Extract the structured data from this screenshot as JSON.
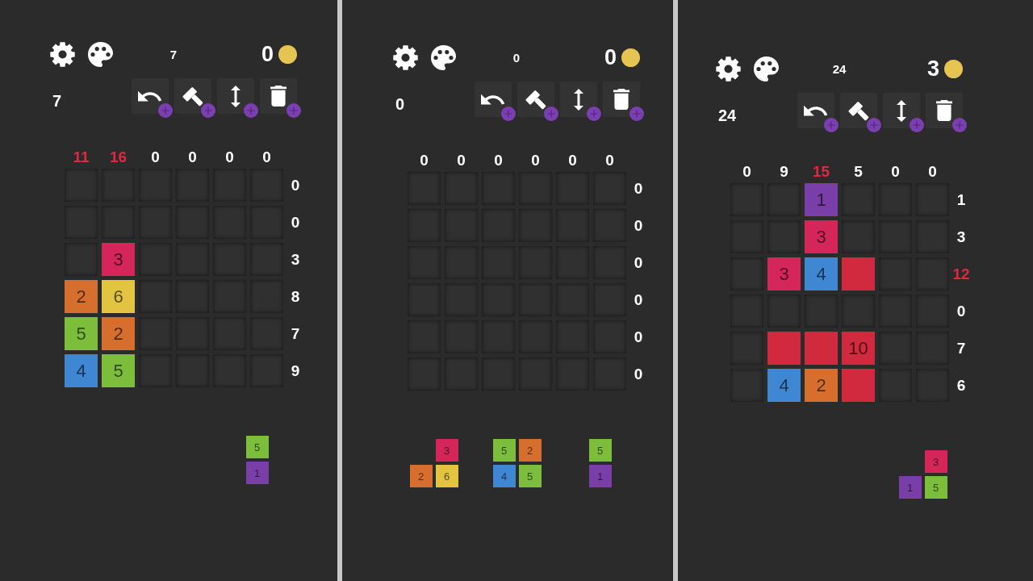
{
  "panels": [
    {
      "top_number": "7",
      "coins": "0",
      "side_number": "7",
      "tools": [
        {
          "kind": "undo",
          "add_badge": true
        },
        {
          "kind": "hammer",
          "add_badge": true
        },
        {
          "kind": "arrows",
          "add_badge": true
        },
        {
          "kind": "trash",
          "add_badge": true
        }
      ],
      "grid": {
        "column_sums": [
          {
            "text": "11",
            "over_limit": true
          },
          {
            "text": "16",
            "over_limit": true
          },
          {
            "text": "0",
            "over_limit": false
          },
          {
            "text": "0",
            "over_limit": false
          },
          {
            "text": "0",
            "over_limit": false
          },
          {
            "text": "0",
            "over_limit": false
          }
        ],
        "rows": [
          {
            "sum": {
              "text": "0",
              "over_limit": false
            },
            "cells": [
              {
                "kind": "empty"
              },
              {
                "kind": "empty"
              },
              {
                "kind": "empty"
              },
              {
                "kind": "empty"
              },
              {
                "kind": "empty"
              },
              {
                "kind": "empty"
              }
            ]
          },
          {
            "sum": {
              "text": "0",
              "over_limit": false
            },
            "cells": [
              {
                "kind": "empty"
              },
              {
                "kind": "empty"
              },
              {
                "kind": "empty"
              },
              {
                "kind": "empty"
              },
              {
                "kind": "empty"
              },
              {
                "kind": "empty"
              }
            ]
          },
          {
            "sum": {
              "text": "3",
              "over_limit": false
            },
            "cells": [
              {
                "kind": "empty"
              },
              {
                "kind": "tile",
                "value": "3",
                "color": "#d42658"
              },
              {
                "kind": "empty"
              },
              {
                "kind": "empty"
              },
              {
                "kind": "empty"
              },
              {
                "kind": "empty"
              }
            ]
          },
          {
            "sum": {
              "text": "8",
              "over_limit": false
            },
            "cells": [
              {
                "kind": "tile",
                "value": "2",
                "color": "#d66e2d"
              },
              {
                "kind": "tile",
                "value": "6",
                "color": "#e3c441"
              },
              {
                "kind": "empty"
              },
              {
                "kind": "empty"
              },
              {
                "kind": "empty"
              },
              {
                "kind": "empty"
              }
            ]
          },
          {
            "sum": {
              "text": "7",
              "over_limit": false
            },
            "cells": [
              {
                "kind": "tile",
                "value": "5",
                "color": "#7cbe3c"
              },
              {
                "kind": "tile",
                "value": "2",
                "color": "#d66e2d"
              },
              {
                "kind": "empty"
              },
              {
                "kind": "empty"
              },
              {
                "kind": "empty"
              },
              {
                "kind": "empty"
              }
            ]
          },
          {
            "sum": {
              "text": "9",
              "over_limit": false
            },
            "cells": [
              {
                "kind": "tile",
                "value": "4",
                "color": "#3f86d3"
              },
              {
                "kind": "tile",
                "value": "5",
                "color": "#7cbe3c"
              },
              {
                "kind": "empty"
              },
              {
                "kind": "empty"
              },
              {
                "kind": "empty"
              },
              {
                "kind": "empty"
              }
            ]
          }
        ]
      },
      "tray": [
        {
          "kind": "empty"
        },
        {
          "kind": "empty"
        },
        {
          "kind": "piece",
          "rows": [
            {
              "cells": [
                {
                  "kind": "tile",
                  "value": "5",
                  "color": "#7cbe3c"
                }
              ]
            },
            {
              "cells": [
                {
                  "kind": "tile",
                  "value": "1",
                  "color": "#7a3ea9"
                }
              ]
            }
          ]
        }
      ]
    },
    {
      "top_number": "0",
      "coins": "0",
      "side_number": "0",
      "tools": [
        {
          "kind": "undo",
          "add_badge": true
        },
        {
          "kind": "hammer",
          "add_badge": true
        },
        {
          "kind": "arrows",
          "add_badge": true
        },
        {
          "kind": "trash",
          "add_badge": true
        }
      ],
      "grid": {
        "column_sums": [
          {
            "text": "0",
            "over_limit": false
          },
          {
            "text": "0",
            "over_limit": false
          },
          {
            "text": "0",
            "over_limit": false
          },
          {
            "text": "0",
            "over_limit": false
          },
          {
            "text": "0",
            "over_limit": false
          },
          {
            "text": "0",
            "over_limit": false
          }
        ],
        "rows": [
          {
            "sum": {
              "text": "0",
              "over_limit": false
            },
            "cells": [
              {
                "kind": "empty"
              },
              {
                "kind": "empty"
              },
              {
                "kind": "empty"
              },
              {
                "kind": "empty"
              },
              {
                "kind": "empty"
              },
              {
                "kind": "empty"
              }
            ]
          },
          {
            "sum": {
              "text": "0",
              "over_limit": false
            },
            "cells": [
              {
                "kind": "empty"
              },
              {
                "kind": "empty"
              },
              {
                "kind": "empty"
              },
              {
                "kind": "empty"
              },
              {
                "kind": "empty"
              },
              {
                "kind": "empty"
              }
            ]
          },
          {
            "sum": {
              "text": "0",
              "over_limit": false
            },
            "cells": [
              {
                "kind": "empty"
              },
              {
                "kind": "empty"
              },
              {
                "kind": "empty"
              },
              {
                "kind": "empty"
              },
              {
                "kind": "empty"
              },
              {
                "kind": "empty"
              }
            ]
          },
          {
            "sum": {
              "text": "0",
              "over_limit": false
            },
            "cells": [
              {
                "kind": "empty"
              },
              {
                "kind": "empty"
              },
              {
                "kind": "empty"
              },
              {
                "kind": "empty"
              },
              {
                "kind": "empty"
              },
              {
                "kind": "empty"
              }
            ]
          },
          {
            "sum": {
              "text": "0",
              "over_limit": false
            },
            "cells": [
              {
                "kind": "empty"
              },
              {
                "kind": "empty"
              },
              {
                "kind": "empty"
              },
              {
                "kind": "empty"
              },
              {
                "kind": "empty"
              },
              {
                "kind": "empty"
              }
            ]
          },
          {
            "sum": {
              "text": "0",
              "over_limit": false
            },
            "cells": [
              {
                "kind": "empty"
              },
              {
                "kind": "empty"
              },
              {
                "kind": "empty"
              },
              {
                "kind": "empty"
              },
              {
                "kind": "empty"
              },
              {
                "kind": "empty"
              }
            ]
          }
        ]
      },
      "tray": [
        {
          "kind": "piece",
          "rows": [
            {
              "cells": [
                {
                  "kind": "gap"
                },
                {
                  "kind": "tile",
                  "value": "3",
                  "color": "#d42658"
                }
              ]
            },
            {
              "cells": [
                {
                  "kind": "tile",
                  "value": "2",
                  "color": "#d66e2d"
                },
                {
                  "kind": "tile",
                  "value": "6",
                  "color": "#e3c441"
                }
              ]
            }
          ]
        },
        {
          "kind": "piece",
          "rows": [
            {
              "cells": [
                {
                  "kind": "tile",
                  "value": "5",
                  "color": "#7cbe3c"
                },
                {
                  "kind": "tile",
                  "value": "2",
                  "color": "#d66e2d"
                }
              ]
            },
            {
              "cells": [
                {
                  "kind": "tile",
                  "value": "4",
                  "color": "#3f86d3"
                },
                {
                  "kind": "tile",
                  "value": "5",
                  "color": "#7cbe3c"
                }
              ]
            }
          ]
        },
        {
          "kind": "piece",
          "rows": [
            {
              "cells": [
                {
                  "kind": "tile",
                  "value": "5",
                  "color": "#7cbe3c"
                }
              ]
            },
            {
              "cells": [
                {
                  "kind": "tile",
                  "value": "1",
                  "color": "#7a3ea9"
                }
              ]
            }
          ]
        }
      ]
    },
    {
      "top_number": "24",
      "coins": "3",
      "side_number": "24",
      "tools": [
        {
          "kind": "undo",
          "add_badge": true
        },
        {
          "kind": "hammer",
          "add_badge": true
        },
        {
          "kind": "arrows",
          "add_badge": true
        },
        {
          "kind": "trash",
          "add_badge": true
        }
      ],
      "grid": {
        "column_sums": [
          {
            "text": "0",
            "over_limit": false
          },
          {
            "text": "9",
            "over_limit": false
          },
          {
            "text": "15",
            "over_limit": true
          },
          {
            "text": "5",
            "over_limit": false
          },
          {
            "text": "0",
            "over_limit": false
          },
          {
            "text": "0",
            "over_limit": false
          }
        ],
        "rows": [
          {
            "sum": {
              "text": "1",
              "over_limit": false
            },
            "cells": [
              {
                "kind": "empty"
              },
              {
                "kind": "empty"
              },
              {
                "kind": "tile",
                "value": "1",
                "color": "#7a3ea9"
              },
              {
                "kind": "empty"
              },
              {
                "kind": "empty"
              },
              {
                "kind": "empty"
              }
            ]
          },
          {
            "sum": {
              "text": "3",
              "over_limit": false
            },
            "cells": [
              {
                "kind": "empty"
              },
              {
                "kind": "empty"
              },
              {
                "kind": "tile",
                "value": "3",
                "color": "#d42658"
              },
              {
                "kind": "empty"
              },
              {
                "kind": "empty"
              },
              {
                "kind": "empty"
              }
            ]
          },
          {
            "sum": {
              "text": "12",
              "over_limit": true
            },
            "cells": [
              {
                "kind": "empty"
              },
              {
                "kind": "tile",
                "value": "3",
                "color": "#d42658"
              },
              {
                "kind": "tile",
                "value": "4",
                "color": "#3f86d3"
              },
              {
                "kind": "tile",
                "color": "#d1293d"
              },
              {
                "kind": "empty"
              },
              {
                "kind": "empty"
              }
            ]
          },
          {
            "sum": {
              "text": "0",
              "over_limit": false
            },
            "cells": [
              {
                "kind": "empty"
              },
              {
                "kind": "empty"
              },
              {
                "kind": "empty"
              },
              {
                "kind": "empty"
              },
              {
                "kind": "empty"
              },
              {
                "kind": "empty"
              }
            ]
          },
          {
            "sum": {
              "text": "7",
              "over_limit": false
            },
            "cells": [
              {
                "kind": "empty"
              },
              {
                "kind": "tile",
                "color": "#d1293d"
              },
              {
                "kind": "tile",
                "color": "#d1293d"
              },
              {
                "kind": "tile",
                "value": "10",
                "color": "#d1293d"
              },
              {
                "kind": "empty"
              },
              {
                "kind": "empty"
              }
            ]
          },
          {
            "sum": {
              "text": "6",
              "over_limit": false
            },
            "cells": [
              {
                "kind": "empty"
              },
              {
                "kind": "tile",
                "value": "4",
                "color": "#3f86d3"
              },
              {
                "kind": "tile",
                "value": "2",
                "color": "#d66e2d"
              },
              {
                "kind": "tile",
                "color": "#d1293d"
              },
              {
                "kind": "empty"
              },
              {
                "kind": "empty"
              }
            ]
          }
        ]
      },
      "tray": [
        {
          "kind": "empty"
        },
        {
          "kind": "empty"
        },
        {
          "kind": "piece",
          "rows": [
            {
              "cells": [
                {
                  "kind": "gap"
                },
                {
                  "kind": "tile",
                  "value": "3",
                  "color": "#d42658"
                }
              ]
            },
            {
              "cells": [
                {
                  "kind": "tile",
                  "value": "1",
                  "color": "#7a3ea9"
                },
                {
                  "kind": "tile",
                  "value": "5",
                  "color": "#7cbe3c"
                }
              ]
            }
          ]
        }
      ]
    }
  ]
}
